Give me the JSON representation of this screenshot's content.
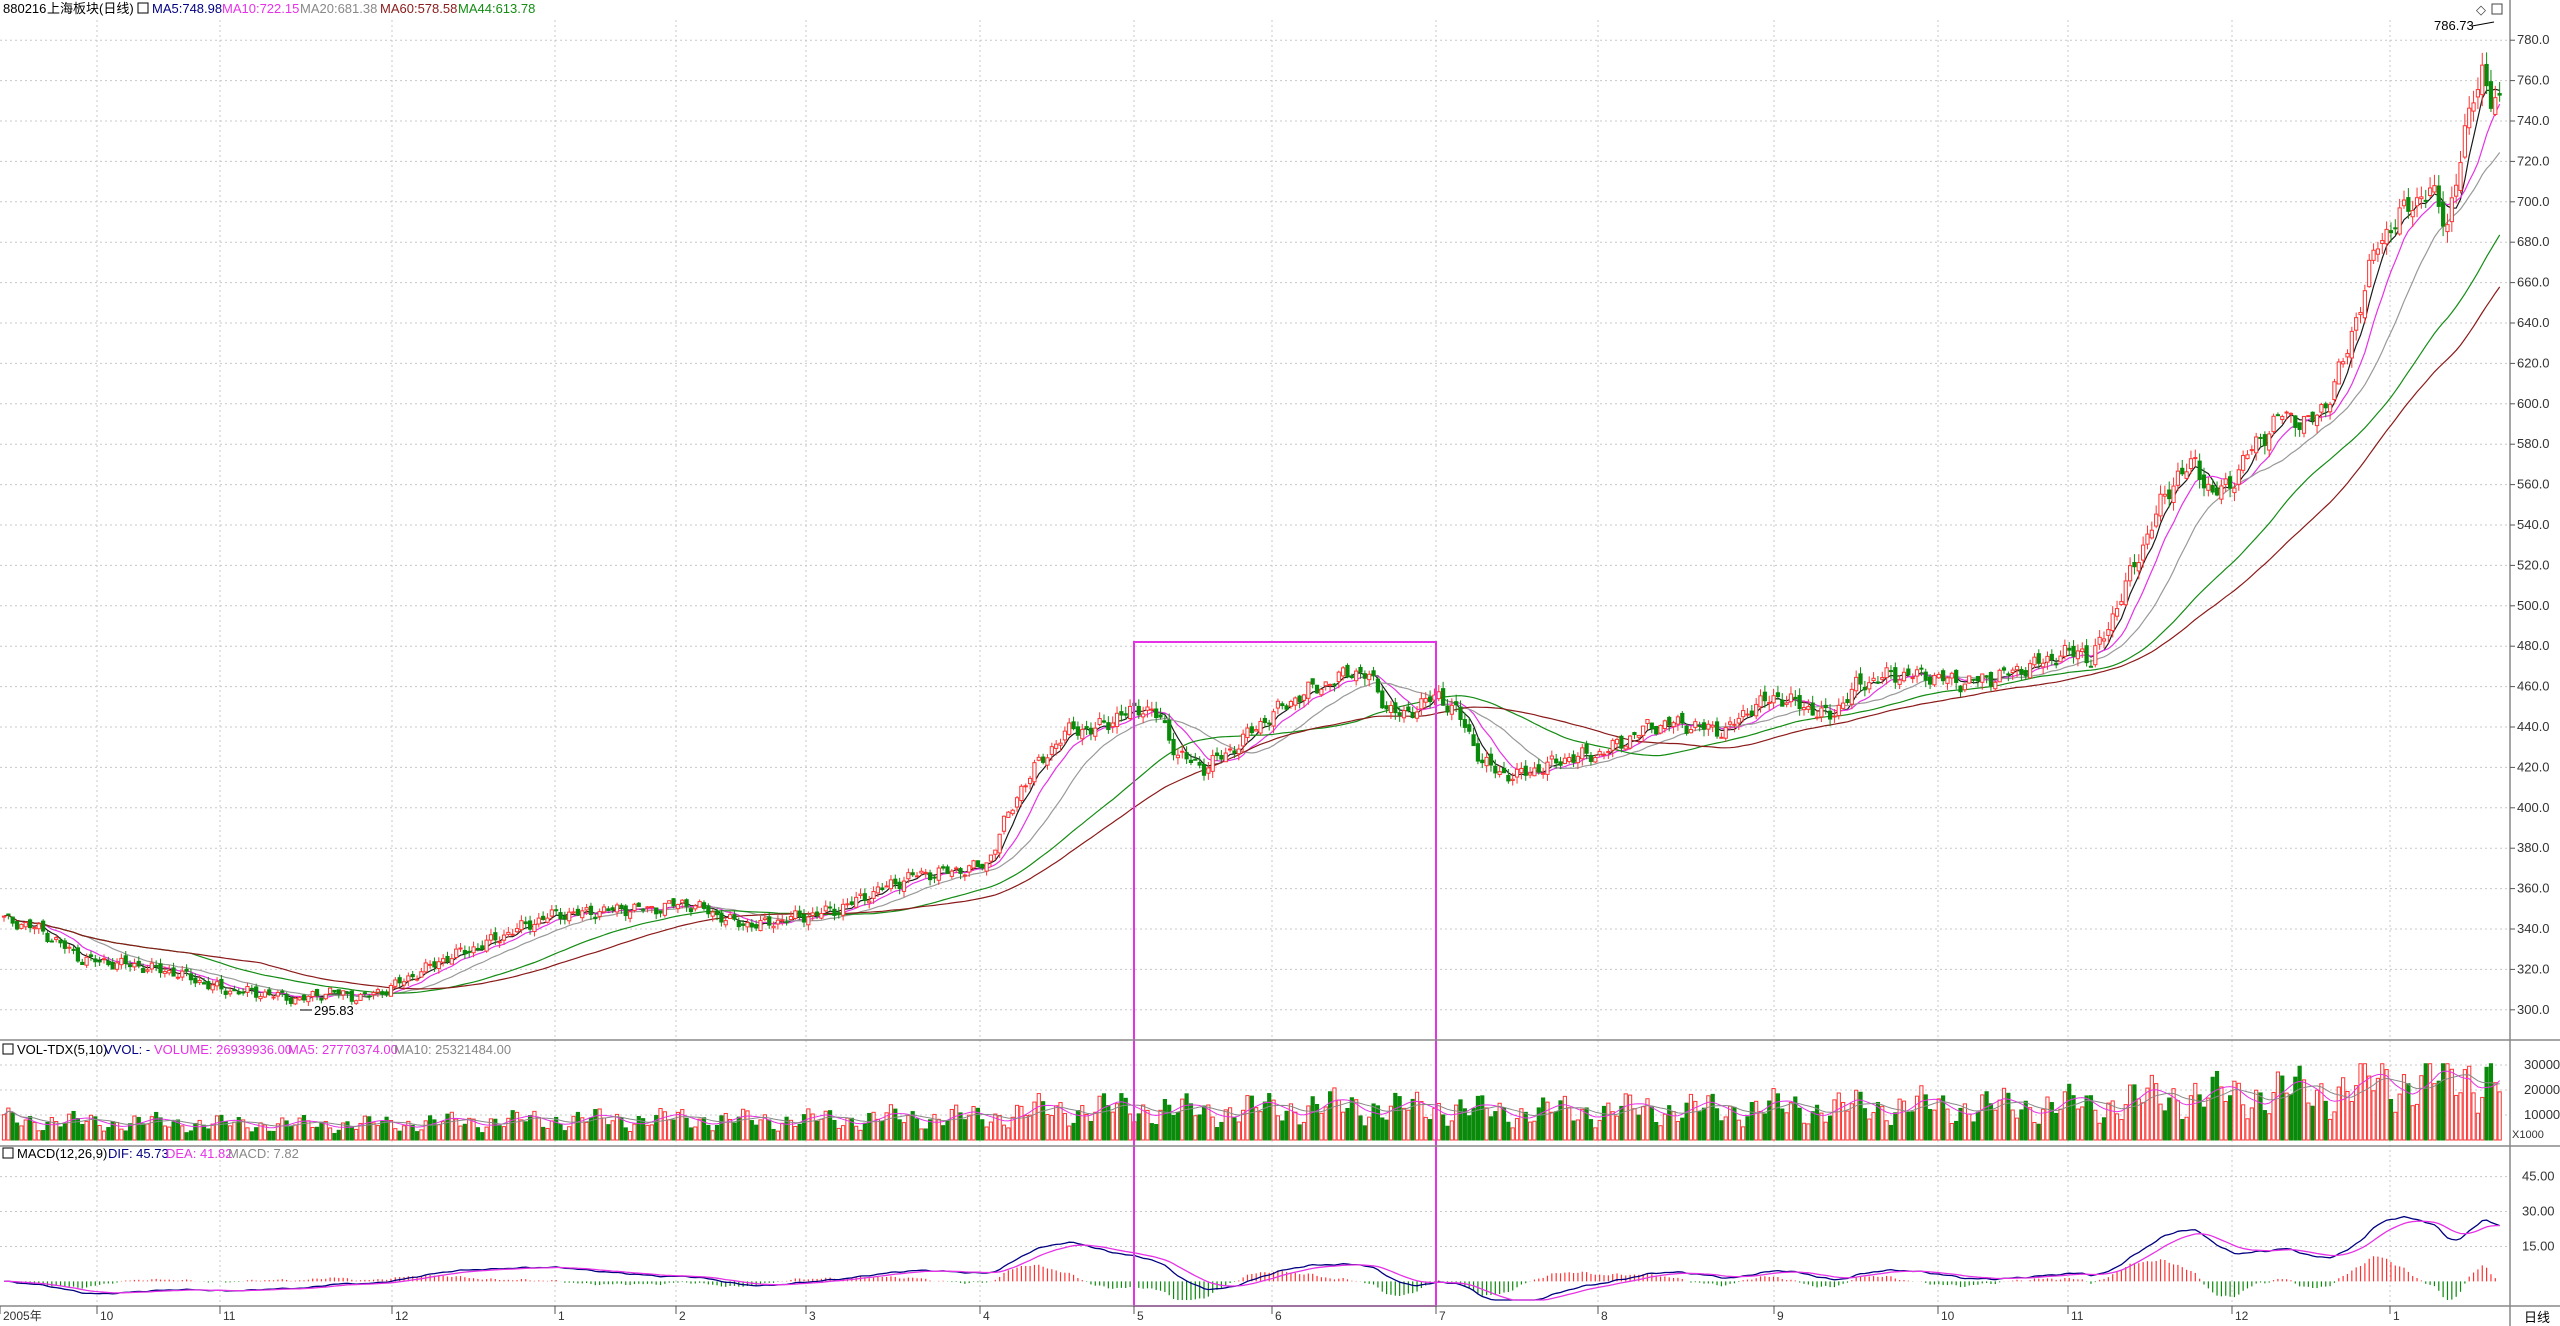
{
  "header": {
    "code": "880216",
    "name": "上海板块(日线)",
    "ma5_label": "MA5:",
    "ma5_value": "748.98",
    "ma10_label": "MA10:",
    "ma10_value": "722.15",
    "ma20_label": "MA20:",
    "ma20_value": "681.38",
    "ma60_label": "MA60:",
    "ma60_value": "578.58",
    "ma44_label": "MA44:",
    "ma44_value": "613.78"
  },
  "volume_header": {
    "title": "VOL-TDX(5,10)",
    "vvol": "VVOL: -",
    "volume": "VOLUME: 26939936.00",
    "ma5": "MA5: 27770374.00",
    "ma10": "MA10: 25321484.00"
  },
  "macd_header": {
    "title": "MACD(12,26,9)",
    "dif": "DIF: 45.73",
    "dea": "DEA: 41.82",
    "macd": "MACD: 7.82"
  },
  "annotations": {
    "high": "786.73",
    "low": "295.83"
  },
  "bottom": {
    "period": "日线"
  },
  "colors": {
    "up": "#ff3232",
    "down": "#0a8a0a",
    "ma5": "#1a1a1a",
    "ma10": "#e632e6",
    "ma20": "#999999",
    "ma60": "#8b1a1a",
    "ma44": "#148c14",
    "dif": "#000080",
    "dea": "#e632e6",
    "grid": "#c8c8c8",
    "select_box": "#e632e6"
  },
  "chart_data": {
    "type": "candlestick",
    "price_axis": {
      "ylim": [
        290,
        790
      ],
      "ticks": [
        "300.0",
        "320.0",
        "340.0",
        "360.0",
        "380.0",
        "400.0",
        "420.0",
        "440.0",
        "460.0",
        "480.0",
        "500.0",
        "520.0",
        "540.0",
        "560.0",
        "580.0",
        "600.0",
        "620.0",
        "640.0",
        "660.0",
        "680.0",
        "700.0",
        "720.0",
        "740.0",
        "760.0",
        "780.0"
      ]
    },
    "volume_axis": {
      "ticks": [
        "10000",
        "20000",
        "30000"
      ],
      "unit": "X1000"
    },
    "macd_axis": {
      "ticks": [
        "15.00",
        "30.00",
        "45.00"
      ]
    },
    "month_labels": [
      "2005年",
      "10",
      "11",
      "12",
      "1",
      "2",
      "3",
      "4",
      "5",
      "6",
      "7",
      "8",
      "9",
      "10",
      "11",
      "12",
      "1"
    ],
    "close_trend": [
      [
        0,
        345
      ],
      [
        8,
        340
      ],
      [
        18,
        325
      ],
      [
        30,
        322
      ],
      [
        40,
        318
      ],
      [
        50,
        310
      ],
      [
        60,
        308
      ],
      [
        68,
        305
      ],
      [
        75,
        309
      ],
      [
        82,
        306
      ],
      [
        88,
        310
      ],
      [
        95,
        318
      ],
      [
        102,
        326
      ],
      [
        110,
        332
      ],
      [
        118,
        340
      ],
      [
        126,
        347
      ],
      [
        134,
        348
      ],
      [
        142,
        350
      ],
      [
        150,
        350
      ],
      [
        156,
        353
      ],
      [
        162,
        349
      ],
      [
        168,
        343
      ],
      [
        174,
        342
      ],
      [
        180,
        345
      ],
      [
        186,
        347
      ],
      [
        192,
        350
      ],
      [
        198,
        356
      ],
      [
        204,
        362
      ],
      [
        210,
        367
      ],
      [
        216,
        368
      ],
      [
        222,
        370
      ],
      [
        226,
        372
      ],
      [
        230,
        392
      ],
      [
        234,
        410
      ],
      [
        238,
        422
      ],
      [
        242,
        432
      ],
      [
        246,
        440
      ],
      [
        250,
        438
      ],
      [
        256,
        445
      ],
      [
        262,
        450
      ],
      [
        266,
        444
      ],
      [
        270,
        426
      ],
      [
        276,
        420
      ],
      [
        282,
        428
      ],
      [
        288,
        440
      ],
      [
        294,
        450
      ],
      [
        300,
        458
      ],
      [
        306,
        463
      ],
      [
        310,
        468
      ],
      [
        314,
        465
      ],
      [
        318,
        450
      ],
      [
        322,
        445
      ],
      [
        326,
        452
      ],
      [
        330,
        455
      ],
      [
        334,
        448
      ],
      [
        336,
        440
      ],
      [
        340,
        423
      ],
      [
        344,
        417
      ],
      [
        348,
        416
      ],
      [
        354,
        420
      ],
      [
        360,
        425
      ],
      [
        366,
        426
      ],
      [
        372,
        432
      ],
      [
        378,
        440
      ],
      [
        384,
        442
      ],
      [
        390,
        440
      ],
      [
        396,
        438
      ],
      [
        402,
        450
      ],
      [
        408,
        455
      ],
      [
        414,
        450
      ],
      [
        420,
        445
      ],
      [
        426,
        460
      ],
      [
        432,
        465
      ],
      [
        438,
        466
      ],
      [
        444,
        465
      ],
      [
        450,
        462
      ],
      [
        456,
        464
      ],
      [
        460,
        466
      ],
      [
        466,
        470
      ],
      [
        472,
        475
      ],
      [
        478,
        478
      ],
      [
        480,
        472
      ],
      [
        484,
        490
      ],
      [
        488,
        510
      ],
      [
        492,
        530
      ],
      [
        496,
        550
      ],
      [
        500,
        565
      ],
      [
        504,
        570
      ],
      [
        508,
        555
      ],
      [
        512,
        560
      ],
      [
        516,
        575
      ],
      [
        520,
        585
      ],
      [
        524,
        595
      ],
      [
        530,
        590
      ],
      [
        534,
        600
      ],
      [
        538,
        620
      ],
      [
        542,
        650
      ],
      [
        546,
        680
      ],
      [
        550,
        690
      ],
      [
        554,
        700
      ],
      [
        558,
        705
      ],
      [
        562,
        690
      ],
      [
        565,
        720
      ],
      [
        568,
        755
      ],
      [
        570,
        765
      ],
      [
        572,
        748
      ]
    ]
  }
}
